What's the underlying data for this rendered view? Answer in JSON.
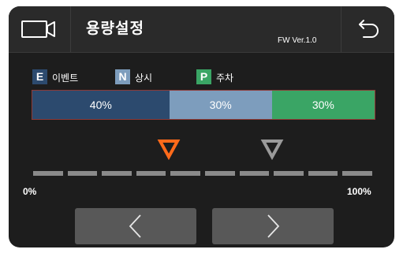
{
  "header": {
    "title": "용량설정",
    "firmware": "FW Ver.1.0",
    "camera_icon": "video-camera-icon",
    "back_icon": "undo-back-arrow-icon"
  },
  "legend": [
    {
      "key": "E",
      "label": "이벤트",
      "color": "#2c4a6e"
    },
    {
      "key": "N",
      "label": "상시",
      "color": "#7d9dbd"
    },
    {
      "key": "P",
      "label": "주차",
      "color": "#3aa565"
    }
  ],
  "capacity_bar": {
    "segments": [
      {
        "name": "event",
        "label": "40%",
        "percent": 40,
        "color": "#2c4a6e"
      },
      {
        "name": "normal",
        "label": "30%",
        "percent": 30,
        "color": "#7d9dbd"
      },
      {
        "name": "parking",
        "label": "30%",
        "percent": 30,
        "color": "#3aa565"
      }
    ]
  },
  "scale": {
    "min_label": "0%",
    "max_label": "100%",
    "steps": 10,
    "markers": [
      {
        "name": "selected-divider-marker",
        "color": "#ff6a1a",
        "position_percent": 40
      },
      {
        "name": "second-divider-marker",
        "color": "#9a9a9a",
        "position_percent": 70
      }
    ]
  },
  "navigation": {
    "prev_icon": "chevron-left-icon",
    "next_icon": "chevron-right-icon"
  },
  "colors": {
    "background": "#1d1d1d",
    "header": "#2a2a2a",
    "accent": "#ff6a1a",
    "scale_dash": "#8a8a8a",
    "button": "#585858"
  }
}
